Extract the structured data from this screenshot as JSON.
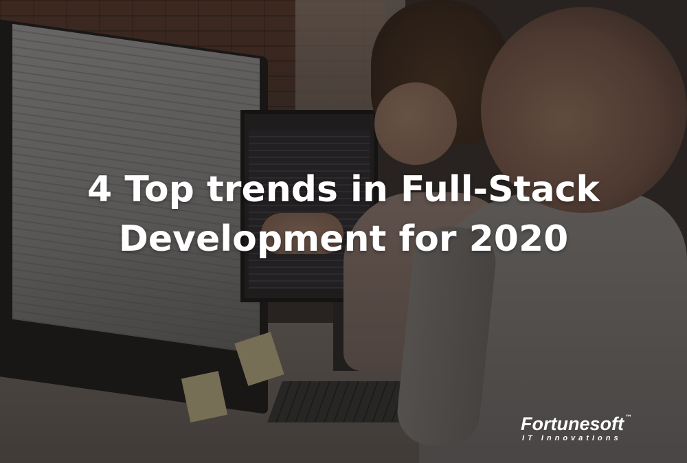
{
  "headline": {
    "line1": "4 Top trends in Full-Stack",
    "line2": "Development for 2020"
  },
  "logo": {
    "name": "Fortunesoft",
    "trademark": "™",
    "tagline": "IT Innovations"
  },
  "colors": {
    "headline_text": "#ffffff",
    "logo_text": "#ffffff",
    "overlay": "#19161466"
  }
}
